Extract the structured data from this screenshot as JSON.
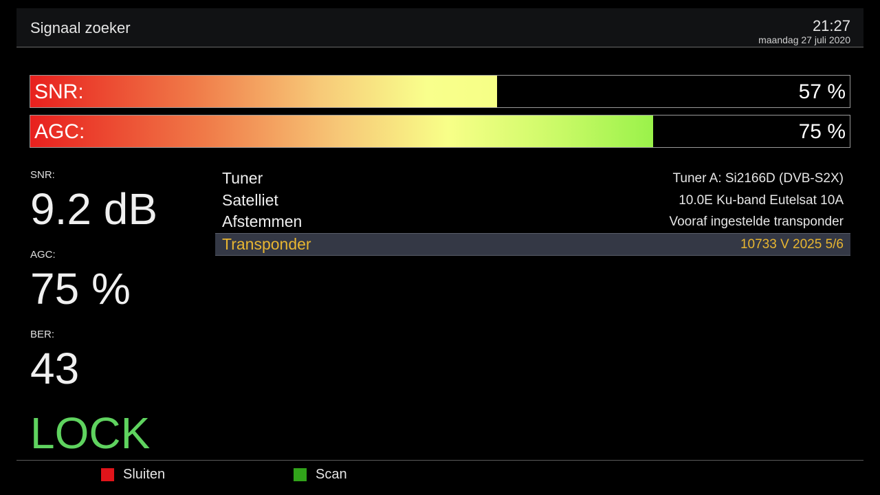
{
  "header": {
    "title": "Signaal zoeker",
    "time": "21:27",
    "date": "maandag 27 juli 2020"
  },
  "bars": {
    "snr": {
      "label": "SNR:",
      "percent_text": "57 %",
      "fill_fraction": 0.57
    },
    "agc": {
      "label": "AGC:",
      "percent_text": "75 %",
      "fill_fraction": 0.76
    }
  },
  "stats": {
    "snr_label": "SNR:",
    "snr_value": "9.2 dB",
    "agc_label": "AGC:",
    "agc_value": "75 %",
    "ber_label": "BER:",
    "ber_value": "43",
    "lock_status": "LOCK"
  },
  "info_rows": [
    {
      "key": "Tuner",
      "value": "Tuner A: Si2166D (DVB-S2X)"
    },
    {
      "key": "Satelliet",
      "value": "10.0E Ku-band Eutelsat 10A"
    },
    {
      "key": "Afstemmen",
      "value": "Vooraf ingestelde transponder"
    },
    {
      "key": "Transponder",
      "value": "10733 V 2025 5/6",
      "selected": true
    }
  ],
  "footer": {
    "red_label": "Sluiten",
    "green_label": "Scan"
  },
  "colors": {
    "red_button": "#e0141a",
    "green_button": "#31a31a",
    "lock": "#5fd35f",
    "selected_text": "#e8b631"
  }
}
